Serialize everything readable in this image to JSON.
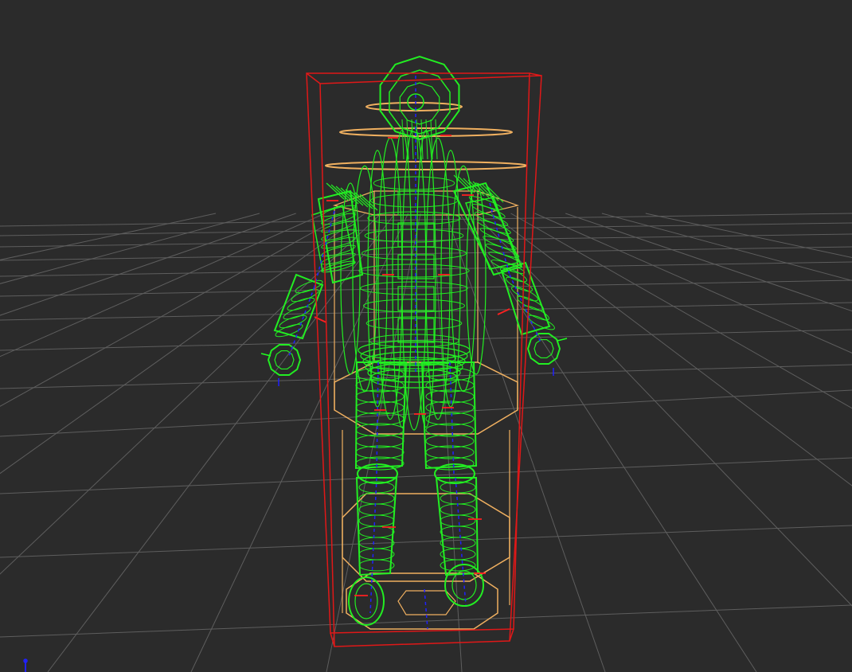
{
  "scene": {
    "background": "#2b2b2b",
    "grid_color": "#5e5e5e",
    "bounding_box_color": "#e01818",
    "capsule_color": "#f0b060",
    "ragdoll_color": "#22ee22",
    "bone_axis_color": "#2020ff",
    "joint_axis_x_color": "#ff2020",
    "joint_axis_y_color": "#20ff20",
    "objects": [
      {
        "name": "viewport-grid",
        "kind": "grid"
      },
      {
        "name": "character-bounding-box",
        "kind": "wireframe-box"
      },
      {
        "name": "character-capsule-collider",
        "kind": "wireframe-capsule"
      },
      {
        "name": "ragdoll-colliders",
        "kind": "wireframe-ragdoll"
      },
      {
        "name": "world-origin-gizmo",
        "kind": "axis-gizmo"
      }
    ]
  }
}
